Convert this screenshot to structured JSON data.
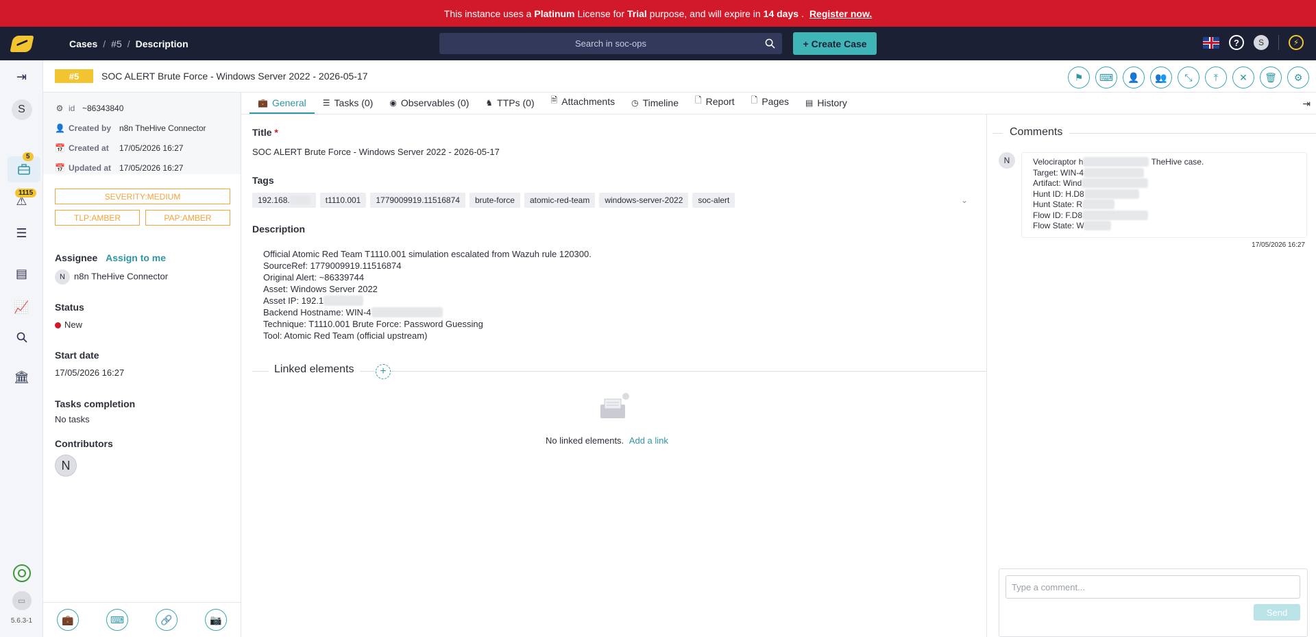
{
  "banner": {
    "part1": "This instance uses a",
    "license": "Platinum",
    "part2": "License for",
    "purpose": "Trial",
    "part3": "purpose, and will expire in",
    "days": "14 days",
    "part4": ".",
    "register": "Register now."
  },
  "nav": {
    "crumbs": [
      "Cases",
      "#5",
      "Description"
    ],
    "search_placeholder": "Search in soc-ops",
    "create_case": "Create Case",
    "user_initial": "S",
    "help": "?"
  },
  "rail": {
    "user_initial": "S",
    "cases_badge": "5",
    "alerts_badge": "1115",
    "version": "5.6.3-1"
  },
  "case": {
    "number": "#5",
    "title": "SOC ALERT Brute Force - Windows Server 2022 - 2026-05-17"
  },
  "meta": {
    "id_label": "id",
    "id_value": "~86343840",
    "created_by_label": "Created by",
    "created_by": "n8n TheHive Connector",
    "created_at_label": "Created at",
    "created_at": "17/05/2026 16:27",
    "updated_at_label": "Updated at",
    "updated_at": "17/05/2026 16:27"
  },
  "pills": {
    "severity": "SEVERITY:MEDIUM",
    "tlp": "TLP:AMBER",
    "pap": "PAP:AMBER"
  },
  "details": {
    "assignee_label": "Assignee",
    "assign_to_me": "Assign to me",
    "assignee_initial": "N",
    "assignee": "n8n TheHive Connector",
    "status_label": "Status",
    "status": "New",
    "start_label": "Start date",
    "start": "17/05/2026 16:27",
    "tasks_label": "Tasks completion",
    "tasks": "No tasks",
    "contributors_label": "Contributors",
    "contributor_initial": "N"
  },
  "tabs": [
    "General",
    "Tasks (0)",
    "Observables (0)",
    "TTPs (0)",
    "Attachments",
    "Timeline",
    "Report",
    "Pages",
    "History"
  ],
  "general": {
    "title_label": "Title",
    "title": "SOC ALERT Brute Force - Windows Server 2022 - 2026-05-17",
    "tags_label": "Tags",
    "tags": [
      "192.168.",
      "t1110.001",
      "1779009919.11516874",
      "brute-force",
      "atomic-red-team",
      "windows-server-2022",
      "soc-alert"
    ],
    "description_label": "Description",
    "description": [
      "Official Atomic Red Team T1110.001 simulation escalated from Wazuh rule 120300.",
      "SourceRef: 1779009919.11516874",
      "Original Alert: ~86339744",
      "Asset: Windows Server 2022",
      "Asset IP: 192.1",
      "Backend Hostname: WIN-4",
      "Technique: T1110.001 Brute Force: Password Guessing",
      "Tool: Atomic Red Team (official upstream)"
    ],
    "linked_title": "Linked elements",
    "no_linked": "No linked elements.",
    "add_link": "Add a link"
  },
  "comments": {
    "title": "Comments",
    "author_initial": "N",
    "lines": [
      "Velociraptor h",
      "TheHive case.",
      "Target: WIN-4",
      "Artifact: Wind",
      "Hunt ID: H.D8",
      "Hunt State: R",
      "Flow ID: F.D8",
      "Flow State: W"
    ],
    "date": "17/05/2026 16:27",
    "input_placeholder": "Type a comment...",
    "send": "Send"
  },
  "colors": {
    "banner": "#d1192a",
    "nav": "#1c2035",
    "accent": "#3fb5b8",
    "case_badge": "#f2c530",
    "amber": "#f0a43a"
  }
}
